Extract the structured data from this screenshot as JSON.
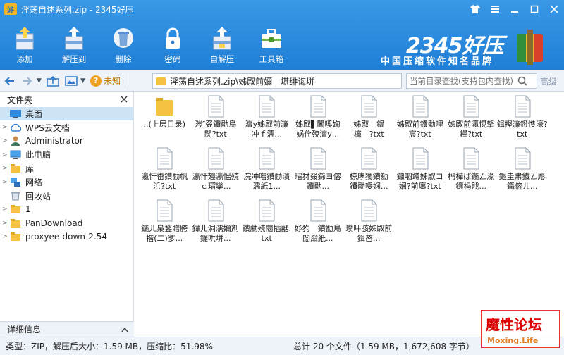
{
  "window": {
    "title": "淫荡自述系列.zip - 2345好压",
    "icon_text": "好"
  },
  "toolbar": {
    "buttons": [
      {
        "label": "添加",
        "icon": "add-icon"
      },
      {
        "label": "解压到",
        "icon": "extract-icon"
      },
      {
        "label": "删除",
        "icon": "delete-icon"
      },
      {
        "label": "密码",
        "icon": "lock-icon"
      },
      {
        "label": "自解压",
        "icon": "self-extract-icon"
      },
      {
        "label": "工具箱",
        "icon": "toolbox-icon"
      }
    ]
  },
  "brand": {
    "name": "2345好压",
    "slogan": "中国压缩软件知名品牌"
  },
  "nav": {
    "unknown_label": "未知",
    "path": "淫荡自述系列.zip\\姊叞前嬭　堪绯诲垪",
    "search_placeholder": "当前目录查找(支持包内查找)",
    "advanced_label": "高级"
  },
  "left_panel": {
    "header": "文件夹",
    "items": [
      {
        "label": "桌面",
        "icon": "desktop-icon",
        "expandable": false,
        "selected": true
      },
      {
        "label": "WPS云文档",
        "icon": "cloud-icon",
        "expandable": true,
        "selected": false
      },
      {
        "label": "Administrator",
        "icon": "user-icon",
        "expandable": true,
        "selected": false
      },
      {
        "label": "此电脑",
        "icon": "computer-icon",
        "expandable": true,
        "selected": false
      },
      {
        "label": "库",
        "icon": "library-icon",
        "expandable": true,
        "selected": false
      },
      {
        "label": "网络",
        "icon": "network-icon",
        "expandable": true,
        "selected": false
      },
      {
        "label": "回收站",
        "icon": "recycle-bin-icon",
        "expandable": false,
        "selected": false
      },
      {
        "label": "1",
        "icon": "folder-icon",
        "expandable": true,
        "selected": false
      },
      {
        "label": "PanDownload",
        "icon": "folder-icon",
        "expandable": true,
        "selected": false
      },
      {
        "label": "proxyee-down-2.54",
        "icon": "folder-icon",
        "expandable": true,
        "selected": false
      }
    ],
    "detail_label": "详细信息"
  },
  "files": [
    {
      "name": "..(上层目录)",
      "type": "folder"
    },
    {
      "name": "涔″叕鐨勫鳥闊?txt",
      "type": "text"
    },
    {
      "name": "澶у姊叞前濂冲ｆ濡...",
      "type": "text"
    },
    {
      "name": "姊叞▌闈嗘婅娲佺殑澶у...",
      "type": "text"
    },
    {
      "name": "姊叞　鎾　欓　?txt",
      "type": "text"
    },
    {
      "name": "姊叞前鐨勫哩宸?txt",
      "type": "text"
    },
    {
      "name": "姊叞前瀛愰拏鑸?txt",
      "type": "text"
    },
    {
      "name": "鍓摼濂鐙愯濠?txt",
      "type": "text"
    },
    {
      "name": "瀛忓畨鐨勫帆浜?txt",
      "type": "text"
    },
    {
      "name": "瀛忓攳瀛愮殑ｃ瑁欒...",
      "type": "text"
    },
    {
      "name": "浣冲噹鐨勫潰濡紙1...",
      "type": "text"
    },
    {
      "name": "瑁犲叕鍗ヨ傛鐨勫...",
      "type": "text"
    },
    {
      "name": "椋庨獨鐨勬　鐨勫噯娴...",
      "type": "text"
    },
    {
      "name": "鐪呬竴姊叞コ娴?前廛?txt",
      "type": "text"
    },
    {
      "name": "杩樺ぱ鍦ㄥ湪鑲杩戝...",
      "type": "text"
    },
    {
      "name": "鏂圭帇鐡ㄥ彫鑷傛ㄦ...",
      "type": "text"
    },
    {
      "name": "鍦ㄦ梟鍫贈胯揩(二)爹...",
      "type": "text"
    },
    {
      "name": "鍏ㄦ洞濡嬭剤鑼哄垪...",
      "type": "text"
    },
    {
      "name": "鐨勮殑闂插嚭.txt",
      "type": "text"
    },
    {
      "name": "妤犳　鐨勫鳥闊滃紙...",
      "type": "text"
    },
    {
      "name": "瓒呯骇姊叞前鍓嶅...",
      "type": "text"
    }
  ],
  "status": {
    "left": "类型：ZIP，解压后大小：1.59 MB，压缩比：51.98%",
    "right": "总计 20 个文件（1.59 MB，1,672,608 字节）"
  },
  "watermark": {
    "line1": "魔性论坛",
    "line2": "Moxing.Life"
  },
  "colors": {
    "accent": "#1f7fd6",
    "selection": "#cde4f7",
    "folder": "#f5c242"
  }
}
